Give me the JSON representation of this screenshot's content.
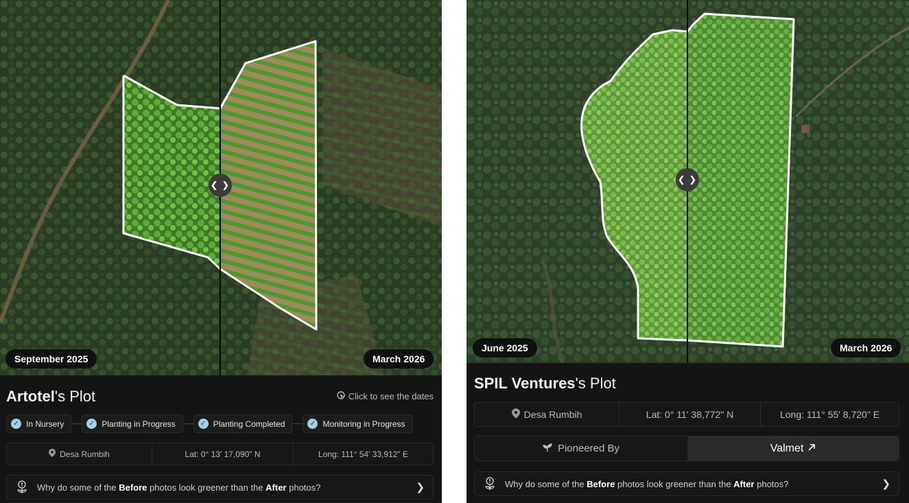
{
  "left_card": {
    "before_date": "September 2025",
    "after_date": "March 2026",
    "title_name": "Artotel",
    "title_suffix": "'s Plot",
    "hint": "Click to see the dates",
    "steps": [
      "In Nursery",
      "Planting in Progress",
      "Planting Completed",
      "Monitoring in Progress"
    ],
    "location": "Desa Rumbih",
    "lat": "Lat: 0° 13' 17,090\" N",
    "long": "Long: 111° 54' 33,912\" E",
    "faq": {
      "prefix": "Why do some of the ",
      "before": "Before",
      "middle": " photos  look greener than the ",
      "after": "After",
      "suffix": " photos?"
    }
  },
  "right_card": {
    "before_date": "June 2025",
    "after_date": "March 2026",
    "title_name": "SPIL Ventures",
    "title_suffix": "'s Plot",
    "location": "Desa Rumbih",
    "lat": "Lat: 0° 11' 38,772\" N",
    "long": "Long: 111° 55' 8,720\" E",
    "pioneered_label": "Pioneered By",
    "pioneer_name": "Valmet",
    "faq": {
      "prefix": "Why do some of the ",
      "before": "Before",
      "middle": " photos  look greener than the ",
      "after": "After",
      "suffix": " photos?"
    }
  },
  "icons": {
    "handle": "compare-arrows-icon",
    "location": "map-pin-icon",
    "check": "check-circle-icon",
    "hint": "cursor-click-icon",
    "faq": "plant-info-icon",
    "chevron": "chevron-right-icon",
    "external": "arrow-up-right-icon",
    "sprout": "sprout-icon"
  },
  "colors": {
    "panel_bg": "#141414",
    "check_bg": "#9fd0e6",
    "boundary": "#ffffff"
  }
}
